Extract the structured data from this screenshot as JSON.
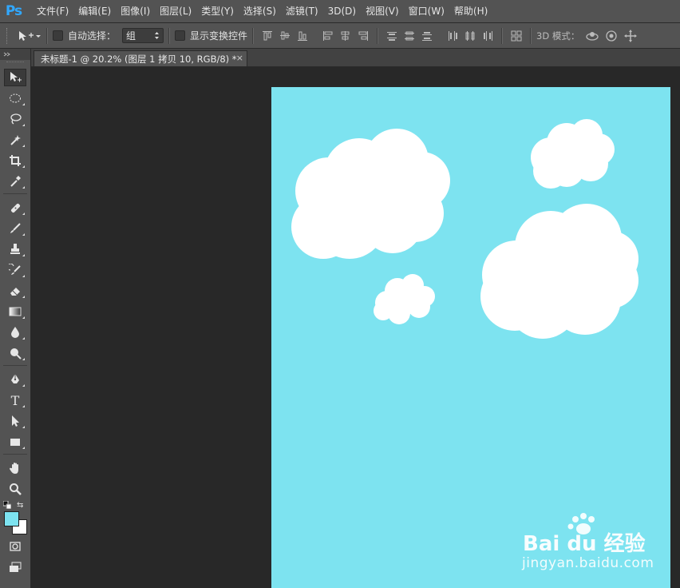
{
  "app": {
    "logo": "Ps"
  },
  "menu": [
    "文件(F)",
    "编辑(E)",
    "图像(I)",
    "图层(L)",
    "类型(Y)",
    "选择(S)",
    "滤镜(T)",
    "3D(D)",
    "视图(V)",
    "窗口(W)",
    "帮助(H)"
  ],
  "options": {
    "auto_select_label": "自动选择：",
    "auto_select_value": "组",
    "show_transform_label": "显示变换控件",
    "mode_3d_label": "3D 模式："
  },
  "document": {
    "tab_title": "未标题-1 @ 20.2% (图层 1 拷贝 10, RGB/8) *",
    "close_glyph": "×"
  },
  "colors": {
    "foreground": "#7de3f0",
    "background": "#ffffff",
    "canvas_bg": "#7de3f0",
    "cloud": "#ffffff"
  },
  "tools": [
    "move-tool",
    "marquee-tool",
    "lasso-tool",
    "magic-wand-tool",
    "crop-tool",
    "eyedropper-tool",
    "healing-brush-tool",
    "brush-tool",
    "clone-stamp-tool",
    "history-brush-tool",
    "eraser-tool",
    "gradient-tool",
    "blur-tool",
    "dodge-tool",
    "pen-tool",
    "type-tool",
    "path-selection-tool",
    "rectangle-tool",
    "hand-tool",
    "zoom-tool"
  ],
  "type_tool_glyph": "T",
  "watermark": {
    "brand": "Bai du 经验",
    "url": "jingyan.baidu.com"
  }
}
